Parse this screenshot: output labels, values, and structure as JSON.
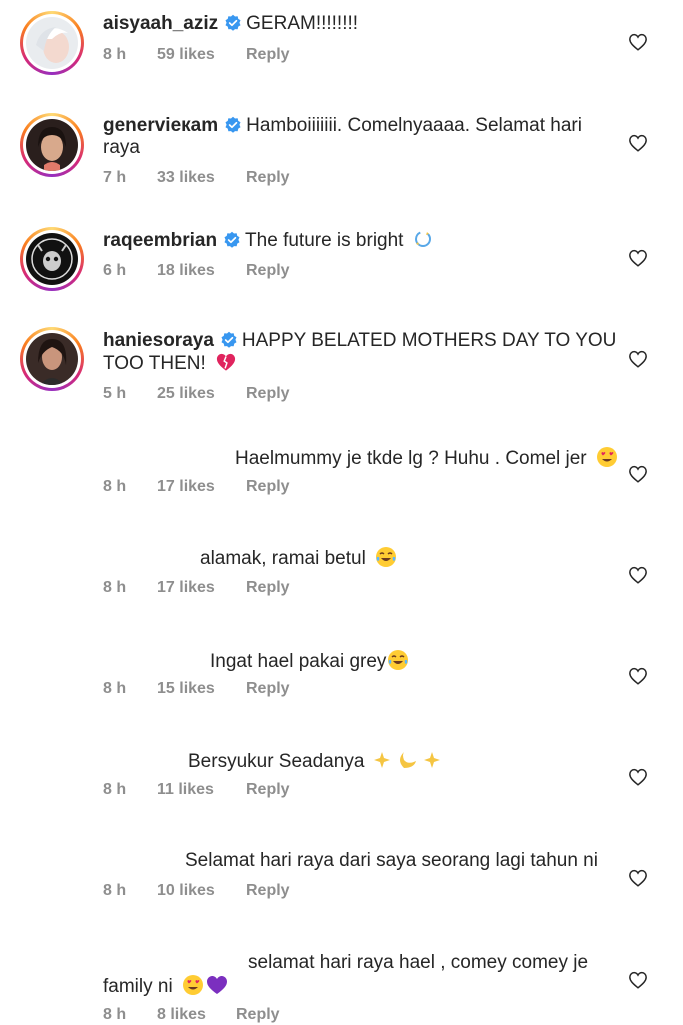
{
  "comments": [
    {
      "username": "aisyaah_aziz",
      "text": "GERAM!!!!!!!!",
      "time": "8 h",
      "likes": "59 likes",
      "reply": "Reply"
    },
    {
      "username": "genervieкam",
      "text_line1": "Hamboiiiiiii. Comelnyaaaa. Selamat hari",
      "text_line2": "raya",
      "time": "7 h",
      "likes": "33 likes",
      "reply": "Reply"
    },
    {
      "username": "raqeembrian",
      "text": "The future is bright",
      "time": "6 h",
      "likes": "18 likes",
      "reply": "Reply"
    },
    {
      "username": "haniesoraya",
      "text_line1": "HAPPY BELATED MOTHERS DAY TO YOU",
      "text_line2": "TOO THEN!",
      "time": "5 h",
      "likes": "25 likes",
      "reply": "Reply"
    },
    {
      "text": "Haelmummy je tkde lg ? Huhu . Comel jer",
      "time": "8 h",
      "likes": "17 likes",
      "reply": "Reply"
    },
    {
      "text": "alamak, ramai betul",
      "time": "8 h",
      "likes": "17 likes",
      "reply": "Reply"
    },
    {
      "text": "Ingat hael pakai grey",
      "time": "8 h",
      "likes": "15 likes",
      "reply": "Reply"
    },
    {
      "text": "Bersyukur Seadanya",
      "time": "8 h",
      "likes": "11 likes",
      "reply": "Reply"
    },
    {
      "text": "Selamat hari raya dari saya seorang lagi tahun ni",
      "time": "8 h",
      "likes": "10 likes",
      "reply": "Reply"
    },
    {
      "text_line1": "selamat hari raya hael , comey comey je",
      "text_line2": "family ni",
      "time": "8 h",
      "likes": "8 likes",
      "reply": "Reply"
    }
  ],
  "icons": {
    "verified": "verified-badge-icon",
    "like": "heart-outline-icon"
  },
  "colors": {
    "verified": "#3897f0",
    "meta": "#8e8e8e",
    "text": "#262626"
  }
}
